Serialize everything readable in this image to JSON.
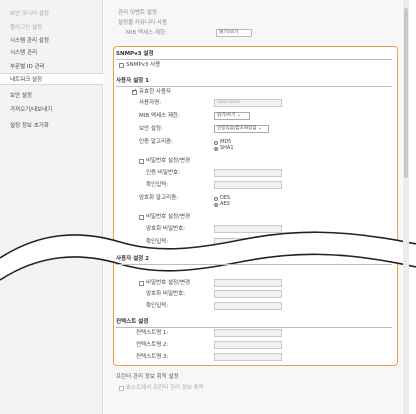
{
  "sidebar": {
    "items": [
      {
        "label": "보안 모니터 설정",
        "dim": true
      },
      {
        "label": "플러그인 설정",
        "dim": true
      },
      {
        "label": "시스템 관리 설정",
        "dim": false
      },
      {
        "label": "시스템 관리",
        "dim": false
      },
      {
        "label": "부문별 ID 관리",
        "dim": false
      },
      {
        "label": "네트워크 설정",
        "dim": false,
        "active": true
      },
      {
        "label": "보안 설정",
        "dim": false
      },
      {
        "label": "가져오기/내보내기",
        "dim": false
      },
      {
        "label": "설정 정보 초기화",
        "dim": false
      }
    ]
  },
  "top": {
    "line1": "관리 이벤트 설정",
    "line2": "설정을 커뮤니티 사용",
    "line3": "MIB 액세스 제한:",
    "select": "읽기/쓰기"
  },
  "snmpv3": {
    "title": "SNMPv3 설정",
    "use_label": "SNMPv3 사용",
    "user1": {
      "title": "사용자 설정 1",
      "enable_label": "유효한 사용자",
      "username_label": "사용자명:",
      "username_placeholder": "username",
      "mib_label": "MIB 액세스 제한:",
      "mib_value": "읽기/쓰기",
      "security_label": "보안 설정:",
      "security_value": "인증있음/암호화있음",
      "auth_algo_label": "인증 알고리즘:",
      "auth_algo_options": [
        "MD5",
        "SHA1"
      ],
      "auth_pw_change_label": "비밀번호 설정/변경",
      "auth_pw_label": "인증 비밀번호:",
      "auth_pw_confirm_label": "확인입력:",
      "enc_algo_label": "암호화 알고리즘:",
      "enc_algo_options": [
        "DES",
        "AES"
      ],
      "enc_pw_change_label": "비밀번호 설정/변경",
      "enc_pw_label": "암호화 비밀번호:",
      "enc_pw_confirm_label": "확인입력:"
    },
    "user2": {
      "title": "사용자 설정 2",
      "pw_change_label": "비밀번호 설정/변경",
      "enc_pw_label": "암호화 비밀번호:",
      "enc_pw_confirm_label": "확인입력:"
    },
    "context": {
      "title": "컨텍스트 설정",
      "items": [
        "컨텍스트명 1:",
        "컨텍스트명 2:",
        "컨텍스트명 3:"
      ]
    }
  },
  "below": {
    "title": "프린터 관리 정보 취득 설정",
    "row": "호스트에서 프린터 관리 정보 취득"
  },
  "colors": {
    "highlight": "#f0a04b"
  }
}
